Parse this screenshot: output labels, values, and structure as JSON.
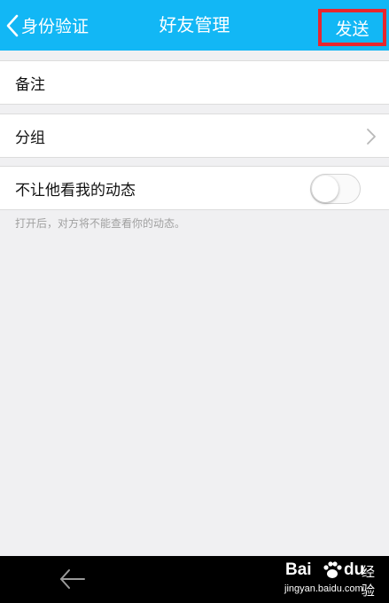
{
  "header": {
    "back_label": "身份验证",
    "title": "好友管理",
    "send_label": "发送",
    "background_color": "#12b7f5",
    "highlight_color": "#e8262e"
  },
  "settings": {
    "remark_label": "备注",
    "group_label": "分组",
    "hide_moments_label": "不让他看我的动态",
    "hide_moments_on": false,
    "hint": "打开后，对方将不能查看你的动态。"
  },
  "watermark": {
    "brand_left": "Bai",
    "brand_right": "du",
    "brand_cn": "经验",
    "url": "jingyan.baidu.com"
  }
}
